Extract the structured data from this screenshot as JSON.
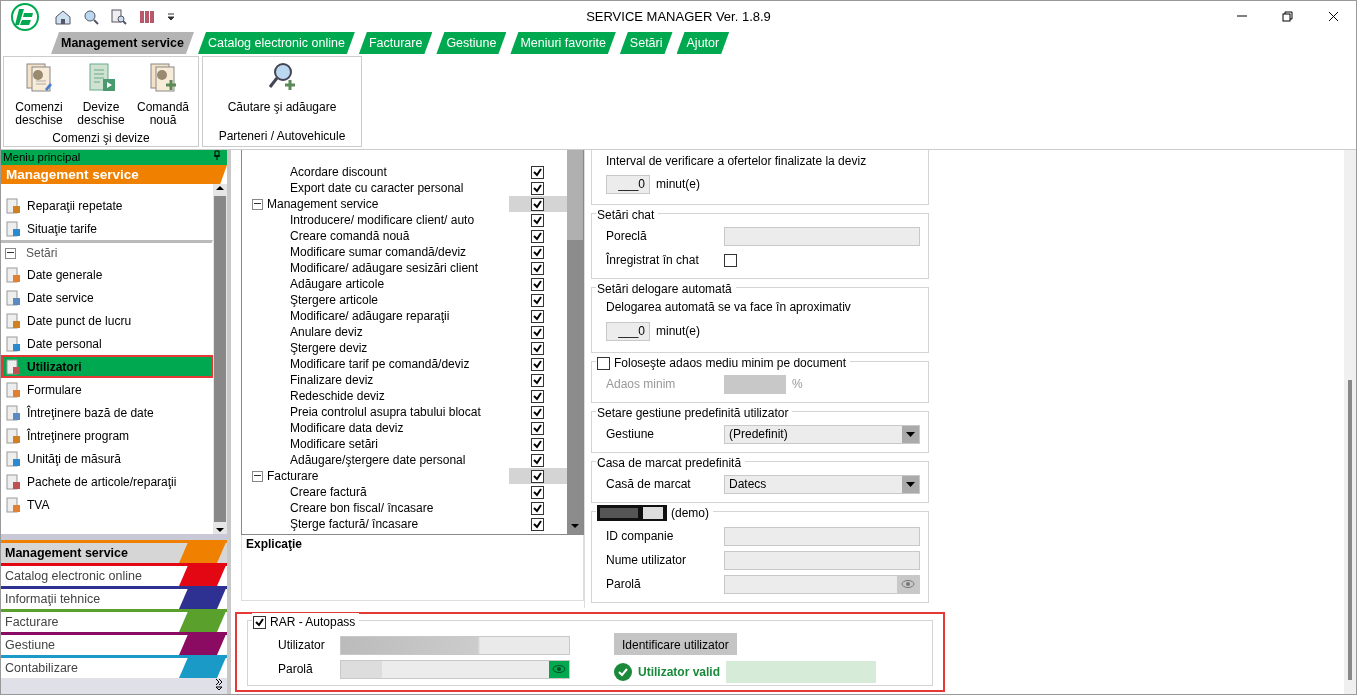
{
  "window": {
    "title": "SERVICE MANAGER Ver. 1.8.9"
  },
  "menu_tabs": [
    {
      "label": "Management service",
      "selected": true
    },
    {
      "label": "Catalog electronic online",
      "selected": false
    },
    {
      "label": "Facturare",
      "selected": false
    },
    {
      "label": "Gestiune",
      "selected": false
    },
    {
      "label": "Meniuri favorite",
      "selected": false
    },
    {
      "label": "Setări",
      "selected": false
    },
    {
      "label": "Ajutor",
      "selected": false
    }
  ],
  "ribbon_groups": [
    {
      "title": "Comenzi şi devize",
      "buttons": [
        {
          "label": "Comenzi deschise",
          "kind": "orders"
        },
        {
          "label": "Devize deschise",
          "kind": "quotes"
        },
        {
          "label": "Comandă nouă",
          "kind": "new"
        }
      ]
    },
    {
      "title": "Parteneri / Autovehicule",
      "buttons": [
        {
          "label": "Căutare şi adăugare",
          "kind": "search"
        }
      ]
    }
  ],
  "sidebar": {
    "title": "Meniu principal",
    "header": "Management service",
    "items": [
      {
        "kind": "item",
        "label": "Reparaţii repetate",
        "selected": false
      },
      {
        "kind": "item",
        "label": "Situaţie tarife",
        "selected": false
      },
      {
        "kind": "section",
        "label": "Setări",
        "expanded": true
      },
      {
        "kind": "item",
        "label": "Date generale",
        "selected": false
      },
      {
        "kind": "item",
        "label": "Date service",
        "selected": false
      },
      {
        "kind": "item",
        "label": "Date punct de lucru",
        "selected": false
      },
      {
        "kind": "item",
        "label": "Date personal",
        "selected": false
      },
      {
        "kind": "item",
        "label": "Utilizatori",
        "selected": true
      },
      {
        "kind": "item",
        "label": "Formulare",
        "selected": false
      },
      {
        "kind": "item",
        "label": "Întreţinere bază de date",
        "selected": false
      },
      {
        "kind": "item",
        "label": "Întreţinere program",
        "selected": false
      },
      {
        "kind": "item",
        "label": "Unităţi de măsură",
        "selected": false
      },
      {
        "kind": "item",
        "label": "Pachete de articole/reparaţii",
        "selected": false
      },
      {
        "kind": "item",
        "label": "TVA",
        "selected": false
      }
    ],
    "modules": [
      {
        "label": "Management service",
        "color": "#f08000",
        "selected": true
      },
      {
        "label": "Catalog electronic online",
        "color": "#e30613",
        "selected": false
      },
      {
        "label": "Informaţii tehnice",
        "color": "#2e3192",
        "selected": false
      },
      {
        "label": "Facturare",
        "color": "#5aa02c",
        "selected": false
      },
      {
        "label": "Gestiune",
        "color": "#8b0a62",
        "selected": false
      },
      {
        "label": "Contabilizare",
        "color": "#1a9bc7",
        "selected": false
      }
    ]
  },
  "permissions": [
    {
      "children": [
        {
          "label": "Acordare discount",
          "checked": true
        },
        {
          "label": "Export date cu caracter personal",
          "checked": true
        }
      ]
    },
    {
      "label": "Management service",
      "checked": true,
      "expanded": true,
      "children": [
        {
          "label": "Introducere/ modificare client/ auto",
          "checked": true
        },
        {
          "label": "Creare comandă nouă",
          "checked": true
        },
        {
          "label": "Modificare sumar comandă/deviz",
          "checked": true
        },
        {
          "label": "Modificare/ adăugare sesizări client",
          "checked": true
        },
        {
          "label": "Adăugare articole",
          "checked": true
        },
        {
          "label": "Ştergere articole",
          "checked": true
        },
        {
          "label": "Modificare/ adăugare reparaţii",
          "checked": true
        },
        {
          "label": "Anulare deviz",
          "checked": true
        },
        {
          "label": "Ştergere deviz",
          "checked": true
        },
        {
          "label": "Modificare tarif pe comandă/deviz",
          "checked": true
        },
        {
          "label": "Finalizare deviz",
          "checked": true
        },
        {
          "label": "Redeschide deviz",
          "checked": true
        },
        {
          "label": "Preia controlul asupra tabului blocat",
          "checked": true
        },
        {
          "label": "Modificare data deviz",
          "checked": true
        },
        {
          "label": "Modificare setări",
          "checked": true
        },
        {
          "label": "Adăugare/ştergere date personal",
          "checked": true
        }
      ]
    },
    {
      "label": "Facturare",
      "checked": true,
      "expanded": true,
      "children": [
        {
          "label": "Creare factură",
          "checked": true
        },
        {
          "label": "Creare bon fiscal/ încasare",
          "checked": true
        },
        {
          "label": "Şterge factură/ încasare",
          "checked": true
        }
      ]
    }
  ],
  "explanation": {
    "title": "Explicaţie"
  },
  "offers": {
    "label": "Interval de verificare a ofertelor finalizate la deviz",
    "value": "___0",
    "unit": "minut(e)"
  },
  "chat": {
    "title": "Setări chat",
    "nickname_label": "Poreclă",
    "registered_label": "Înregistrat în chat",
    "registered": false
  },
  "auto_logout": {
    "title": "Setări delogare automată",
    "label": "Delogarea automată se va face în aproximativ",
    "value": "___0",
    "unit": "minut(e)"
  },
  "min_markup": {
    "title": "Foloseşte adaos mediu minim pe document",
    "checked": false,
    "label": "Adaos minim",
    "unit": "%"
  },
  "stock": {
    "title": "Setare gestiune predefinită utilizator",
    "label": "Gestiune",
    "value": "(Predefinit)"
  },
  "cash_register": {
    "title": "Casa de marcat predefinită",
    "label": "Casă de marcat",
    "value": "Datecs"
  },
  "partslink": {
    "note": "(demo)",
    "company_label": "ID companie",
    "user_label": "Nume utilizator",
    "password_label": "Parolă"
  },
  "rar": {
    "title": "RAR - Autopass",
    "checked": true,
    "user_label": "Utilizator",
    "password_label": "Parolă",
    "button": "Identificare utilizator",
    "status": "Utilizator valid",
    "valid": true
  }
}
